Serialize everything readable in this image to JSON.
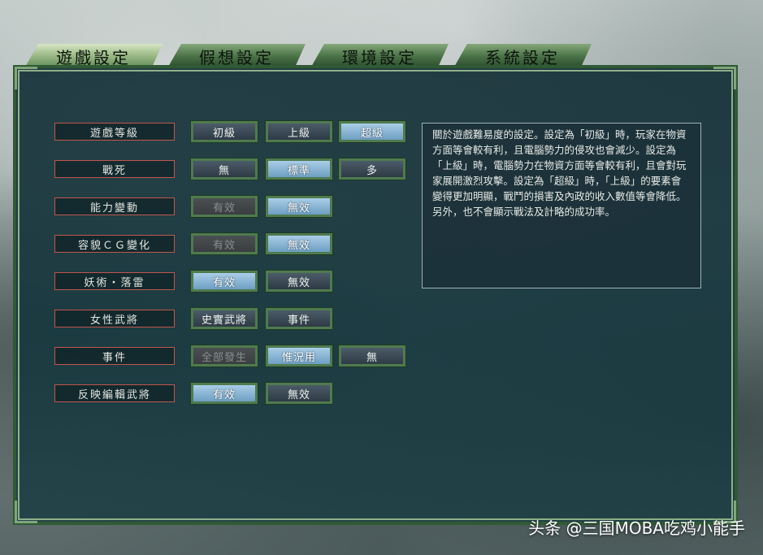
{
  "tabs": [
    "遊戲設定",
    "假想設定",
    "環境設定",
    "系統設定"
  ],
  "settings": [
    {
      "label": "遊戲等級",
      "options": [
        "初級",
        "上級",
        "超級"
      ],
      "states": [
        "off",
        "off",
        "sel"
      ]
    },
    {
      "label": "戰死",
      "options": [
        "無",
        "標準",
        "多"
      ],
      "states": [
        "off",
        "sel",
        "off"
      ]
    },
    {
      "label": "能力變動",
      "options": [
        "有效",
        "無效"
      ],
      "states": [
        "dis",
        "sel"
      ]
    },
    {
      "label": "容貌ＣＧ變化",
      "options": [
        "有效",
        "無效"
      ],
      "states": [
        "dis",
        "sel"
      ]
    },
    {
      "label": "妖術・落雷",
      "options": [
        "有效",
        "無效"
      ],
      "states": [
        "sel",
        "off"
      ]
    },
    {
      "label": "女性武將",
      "options": [
        "史實武將",
        "事件"
      ],
      "states": [
        "off",
        "off"
      ]
    },
    {
      "label": "事件",
      "options": [
        "全部發生",
        "惟況用",
        "無"
      ],
      "states": [
        "dis",
        "sel",
        "off"
      ]
    },
    {
      "label": "反映編輯武將",
      "options": [
        "有效",
        "無效"
      ],
      "states": [
        "sel",
        "off"
      ]
    }
  ],
  "description": "關於遊戲難易度的設定。設定為「初級」時，玩家在物資方面等會較有利，且電腦勢力的侵攻也會減少。設定為「上級」時，電腦勢力在物資方面等會較有利，且會對玩家展開激烈攻擊。設定為「超級」時，「上級」的要素會變得更加明顯，戰鬥的損害及內政的收入數值等會降低。另外，也不會顯示戰法及計略的成功率。",
  "watermark": "头条 @三国MOBA吃鸡小能手"
}
